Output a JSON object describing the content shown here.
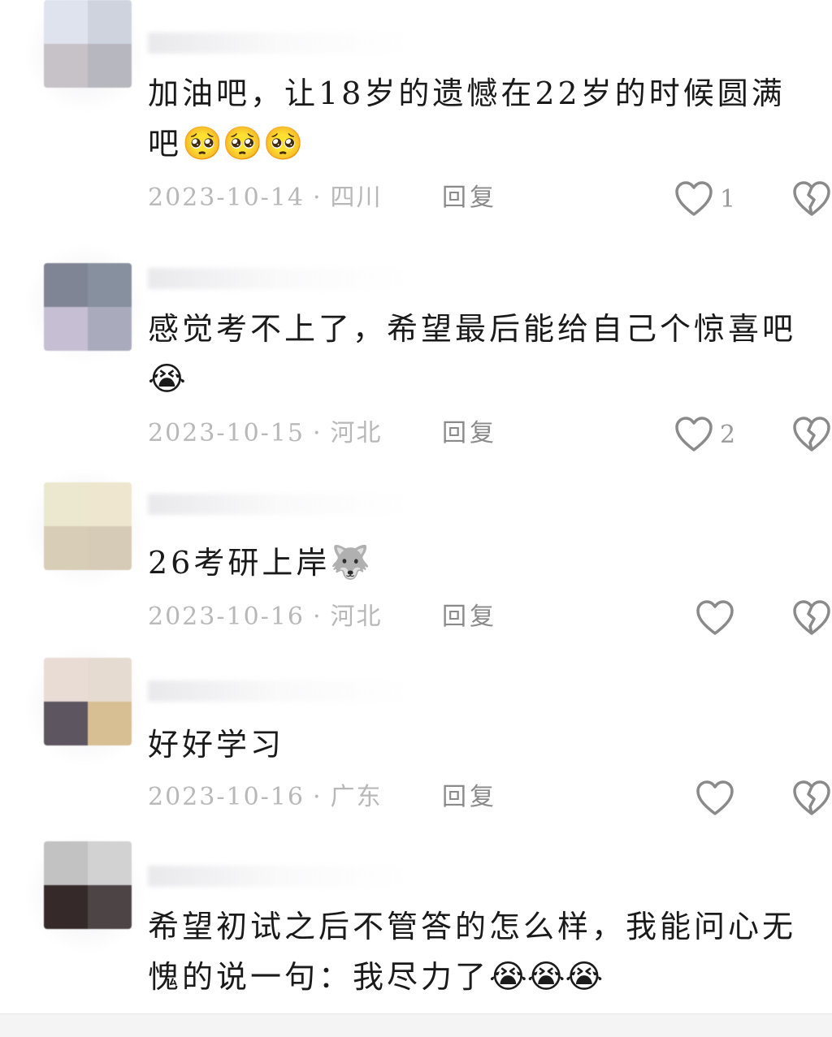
{
  "comments": [
    {
      "text": "加油吧，让18岁的遗憾在22岁的时候圆满吧",
      "emojis": "🥺🥺🥺",
      "date": "2023-10-14",
      "location": "四川",
      "reply_label": "回复",
      "like_count": "1",
      "avatar_colors": [
        "#dfe3ee",
        "#cfd3dd",
        "#c7c1c8",
        "#b7b7c0"
      ]
    },
    {
      "text": "感觉考不上了，希望最后能给自己个惊喜吧",
      "emojis": "😭",
      "date": "2023-10-15",
      "location": "河北",
      "reply_label": "回复",
      "like_count": "2",
      "avatar_colors": [
        "#7f8594",
        "#87909e",
        "#c6bfd4",
        "#a9abbd"
      ]
    },
    {
      "text": "26考研上岸",
      "emojis": "🐺",
      "date": "2023-10-16",
      "location": "河北",
      "reply_label": "回复",
      "like_count": "",
      "avatar_colors": [
        "#ece7cf",
        "#efe6cf",
        "#d8cdb7",
        "#d6cbb6"
      ]
    },
    {
      "text": "好好学习",
      "emojis": "",
      "date": "2023-10-16",
      "location": "广东",
      "reply_label": "回复",
      "like_count": "",
      "avatar_colors": [
        "#e8dcd4",
        "#e6dbd0",
        "#5d5560",
        "#d8bf93"
      ]
    },
    {
      "text": "希望初试之后不管答的怎么样，我能问心无愧的说一句：我尽力了",
      "emojis": "😭😭😭",
      "date": "",
      "location": "",
      "reply_label": "",
      "like_count": "",
      "avatar_colors": [
        "#c2c2c2",
        "#d2d2d2",
        "#352a29",
        "#4d4445"
      ]
    }
  ]
}
